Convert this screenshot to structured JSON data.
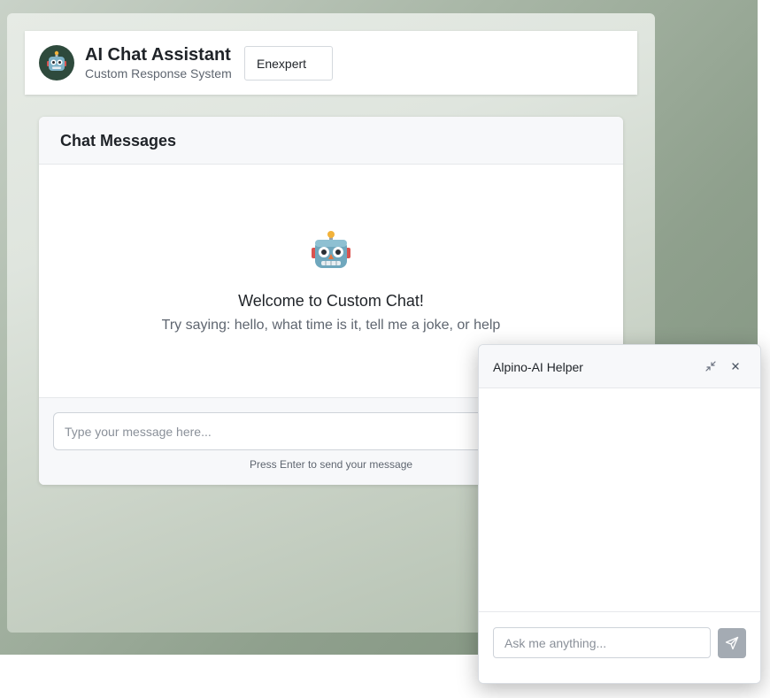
{
  "header": {
    "title": "AI Chat Assistant",
    "subtitle": "Custom Response System",
    "mode_value": "Enexpert",
    "avatar_icon": "robot-icon"
  },
  "chat": {
    "title": "Chat Messages",
    "welcome_icon": "robot-icon",
    "welcome_title": "Welcome to Custom Chat!",
    "welcome_hint": "Try saying: hello, what time is it, tell me a joke, or help",
    "input_placeholder": "Type your message here...",
    "enter_hint": "Press Enter to send your message"
  },
  "helper": {
    "title": "Alpino-AI Helper",
    "minimize_icon": "minimize-icon",
    "close_icon": "close-icon",
    "input_placeholder": "Ask me anything...",
    "send_icon": "send-icon"
  },
  "colors": {
    "avatar_bg": "#2e4a3c",
    "send_button": "#a4abb3",
    "text_primary": "#1f2328",
    "text_secondary": "#5f6670"
  }
}
